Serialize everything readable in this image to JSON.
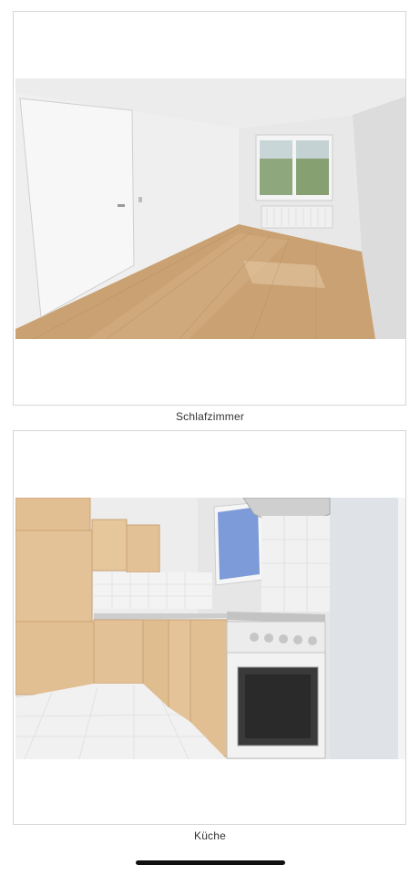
{
  "gallery": {
    "items": [
      {
        "caption": "Schlafzimmer",
        "image_subject": "empty bedroom with laminate floor, white door and window"
      },
      {
        "caption": "Küche",
        "image_subject": "kitchen with beige cabinets, oven and tiled floor"
      }
    ]
  },
  "colors": {
    "background": "#ffffff",
    "card_border": "#d6d6d6",
    "caption_text": "#333333",
    "home_indicator": "#111111"
  }
}
